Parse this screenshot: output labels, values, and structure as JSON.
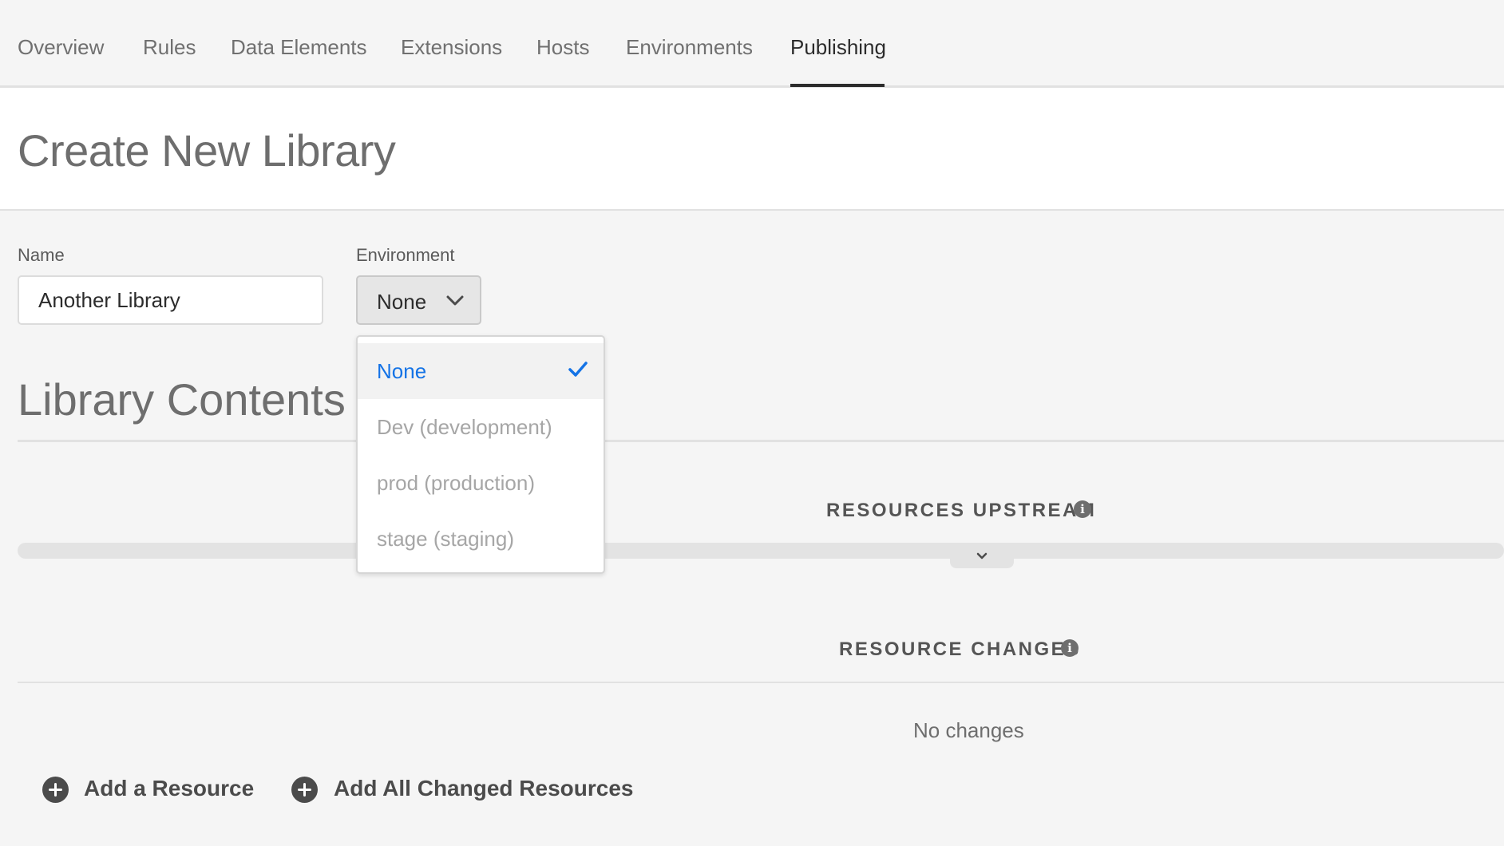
{
  "tabs": [
    {
      "label": "Overview"
    },
    {
      "label": "Rules"
    },
    {
      "label": "Data Elements"
    },
    {
      "label": "Extensions"
    },
    {
      "label": "Hosts"
    },
    {
      "label": "Environments"
    },
    {
      "label": "Publishing",
      "active": true
    }
  ],
  "header": {
    "title": "Create New Library"
  },
  "form": {
    "name_label": "Name",
    "name_value": "Another Library",
    "environment_label": "Environment",
    "environment_value": "None",
    "environment_icon": "chevron-down-icon"
  },
  "dropdown": {
    "options": [
      {
        "label": "None",
        "selected": true,
        "icon": "checkmark-icon"
      },
      {
        "label": "Dev (development)",
        "disabled": true
      },
      {
        "label": "prod (production)",
        "disabled": true
      },
      {
        "label": "stage (staging)",
        "disabled": true
      }
    ]
  },
  "library_contents": {
    "title": "Library Contents",
    "resources_upstream": "RESOURCES UPSTREAM",
    "resource_changes": "RESOURCE CHANGES",
    "info_icon": "info-icon",
    "no_changes": "No changes"
  },
  "actions": {
    "add_resource": "Add a Resource",
    "add_all_changed": "Add All Changed Resources",
    "icon": "plus-circle-icon"
  },
  "colors": {
    "accent": "#1473e6",
    "background": "#f5f5f5",
    "text": "#4b4b4b"
  }
}
